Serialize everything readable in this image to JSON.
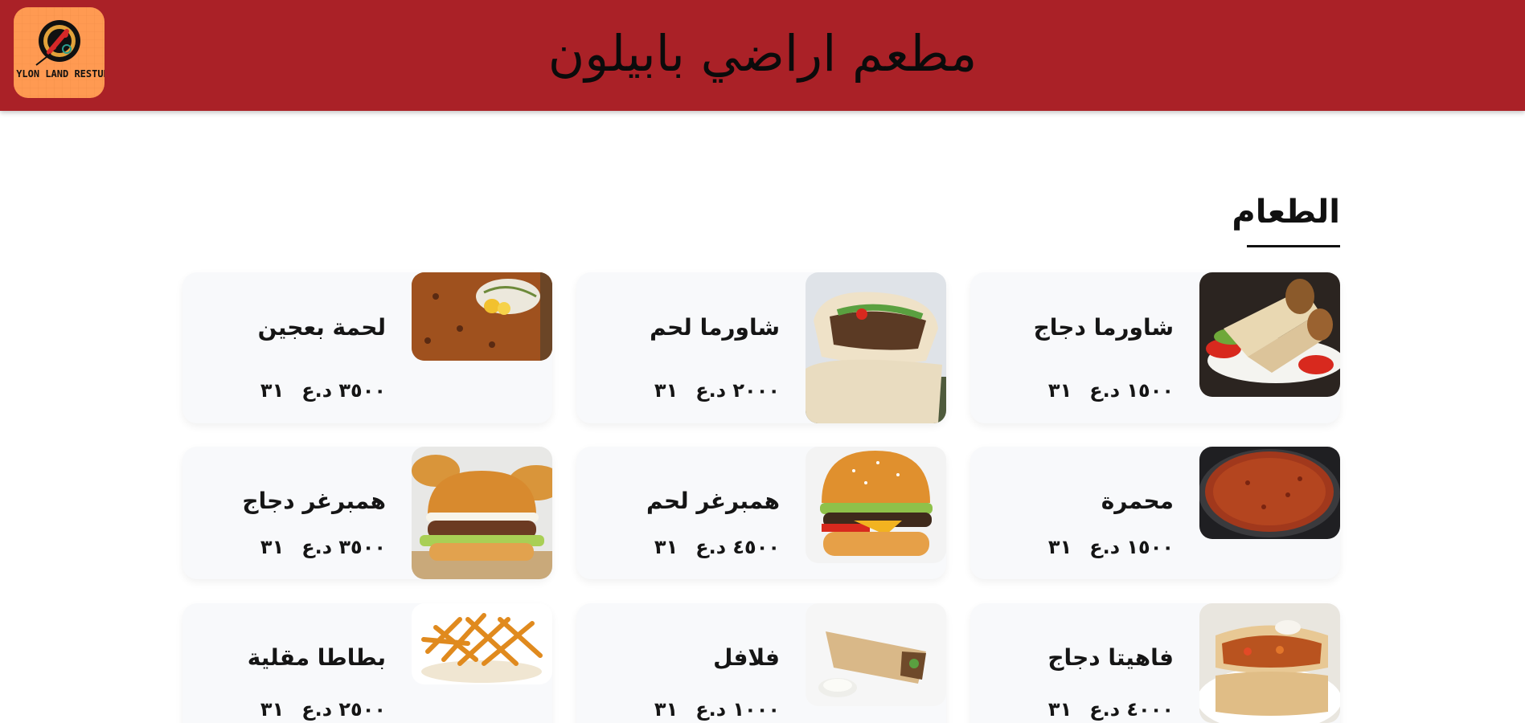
{
  "header": {
    "title": "مطعم اراضي بابيلون",
    "logo_text": "YLON LAND RESTUR"
  },
  "section": {
    "title": "الطعام"
  },
  "items": [
    {
      "name": "شاورما دجاج",
      "price": "١٥٠٠ د.ع",
      "icon": "٣١",
      "image": "chicken-shawarma-image"
    },
    {
      "name": "شاورما لحم",
      "price": "٢٠٠٠ د.ع",
      "icon": "٣١",
      "image": "meat-shawarma-image"
    },
    {
      "name": "لحمة بعجين",
      "price": "٣٥٠٠ د.ع",
      "icon": "٣١",
      "image": "lahm-bi-ajeen-image"
    },
    {
      "name": "محمرة",
      "price": "١٥٠٠ د.ع",
      "icon": "٣١",
      "image": "muhammara-image"
    },
    {
      "name": "همبرغر لحم",
      "price": "٤٥٠٠ د.ع",
      "icon": "٣١",
      "image": "beef-burger-image"
    },
    {
      "name": "همبرغر دجاج",
      "price": "٣٥٠٠ د.ع",
      "icon": "٣١",
      "image": "chicken-burger-image"
    },
    {
      "name": "فاهيتا دجاج",
      "price": "٤٠٠٠ د.ع",
      "icon": "٣١",
      "image": "chicken-fajita-image"
    },
    {
      "name": "فلافل",
      "price": "١٠٠٠ د.ع",
      "icon": "٣١",
      "image": "falafel-image"
    },
    {
      "name": "بطاطا مقلية",
      "price": "٢٥٠٠ د.ع",
      "icon": "٣١",
      "image": "fries-image"
    }
  ],
  "colors": {
    "header_bg": "#aa2127",
    "logo_bg": "#ff9a52",
    "card_bg": "#f8f9fb"
  }
}
